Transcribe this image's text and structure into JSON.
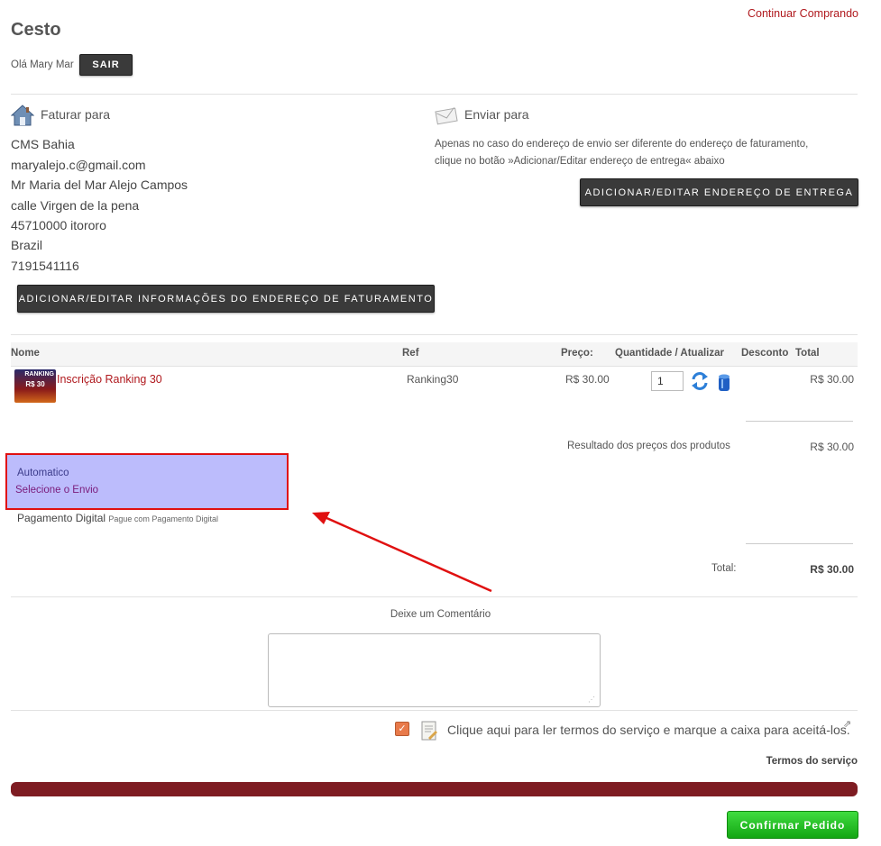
{
  "header": {
    "continue_link": "Continuar Comprando",
    "title": "Cesto",
    "greeting": "Olá Mary Mar",
    "logout_label": "SAIR"
  },
  "billing": {
    "title": "Faturar para",
    "lines": [
      "CMS Bahia",
      "maryalejo.c@gmail.com",
      "Mr Maria del Mar Alejo Campos",
      "calle Virgen de la pena",
      "45710000 itororo",
      "Brazil",
      "7191541116"
    ],
    "button_label": "ADICIONAR/EDITAR INFORMAÇÕES DO ENDEREÇO DE FATURAMENTO"
  },
  "shipping": {
    "title": "Enviar para",
    "note_line1": "Apenas no caso do endereço de envio ser diferente do endereço de faturamento,",
    "note_line2": "clique no botão »Adicionar/Editar endereço de entrega« abaixo",
    "button_label": "ADICIONAR/EDITAR ENDEREÇO DE ENTREGA"
  },
  "table": {
    "headers": {
      "name": "Nome",
      "ref": "Ref",
      "price": "Preço:",
      "qty": "Quantidade / Atualizar",
      "discount": "Desconto",
      "total": "Total"
    },
    "rows": [
      {
        "name": "Inscrição Ranking 30",
        "ref": "Ranking30",
        "price": "R$ 30.00",
        "qty": "1",
        "total": "R$ 30.00",
        "thumb_top": "RANKING",
        "thumb_price": "R$ 30"
      }
    ],
    "subtotal_label": "Resultado dos preços dos produtos",
    "subtotal_value": "R$ 30.00",
    "total_label": "Total:",
    "total_value": "R$ 30.00"
  },
  "shipment": {
    "method": "Automatico",
    "select_link": "Selecione o Envio"
  },
  "payment": {
    "name": "Pagamento Digital",
    "desc": "Pague com Pagamento Digital"
  },
  "comment": {
    "label": "Deixe um Comentário",
    "value": ""
  },
  "terms": {
    "text": "Clique aqui para ler termos do serviço e marque a caixa para aceitá-los.",
    "title": "Termos do serviço",
    "checked": true
  },
  "confirm_label": "Confirmar Pedido",
  "colors": {
    "accent": "#b0191e",
    "dark_button": "#3a3a3a",
    "progress_bar": "#7e1c22",
    "confirm_button": "#22bb22",
    "highlight_fill": "#bcbcfc",
    "highlight_border": "#e01010"
  }
}
